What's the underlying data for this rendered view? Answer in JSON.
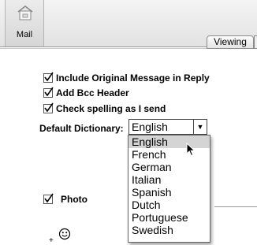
{
  "toolbar": {
    "mail_label": "Mail",
    "mail_icon": "mail-house-icon"
  },
  "tabs": {
    "viewing_label": "Viewing"
  },
  "options": {
    "include_original": {
      "label": "Include Original Message in Reply",
      "checked": true
    },
    "add_bcc": {
      "label": "Add Bcc Header",
      "checked": true
    },
    "check_spelling": {
      "label": "Check spelling as I send",
      "checked": true
    }
  },
  "dictionary": {
    "label": "Default Dictionary:",
    "selected": "English",
    "options": [
      "English",
      "French",
      "German",
      "Italian",
      "Spanish",
      "Dutch",
      "Portuguese",
      "Swedish"
    ]
  },
  "photo": {
    "label": "Photo",
    "checked": true
  }
}
